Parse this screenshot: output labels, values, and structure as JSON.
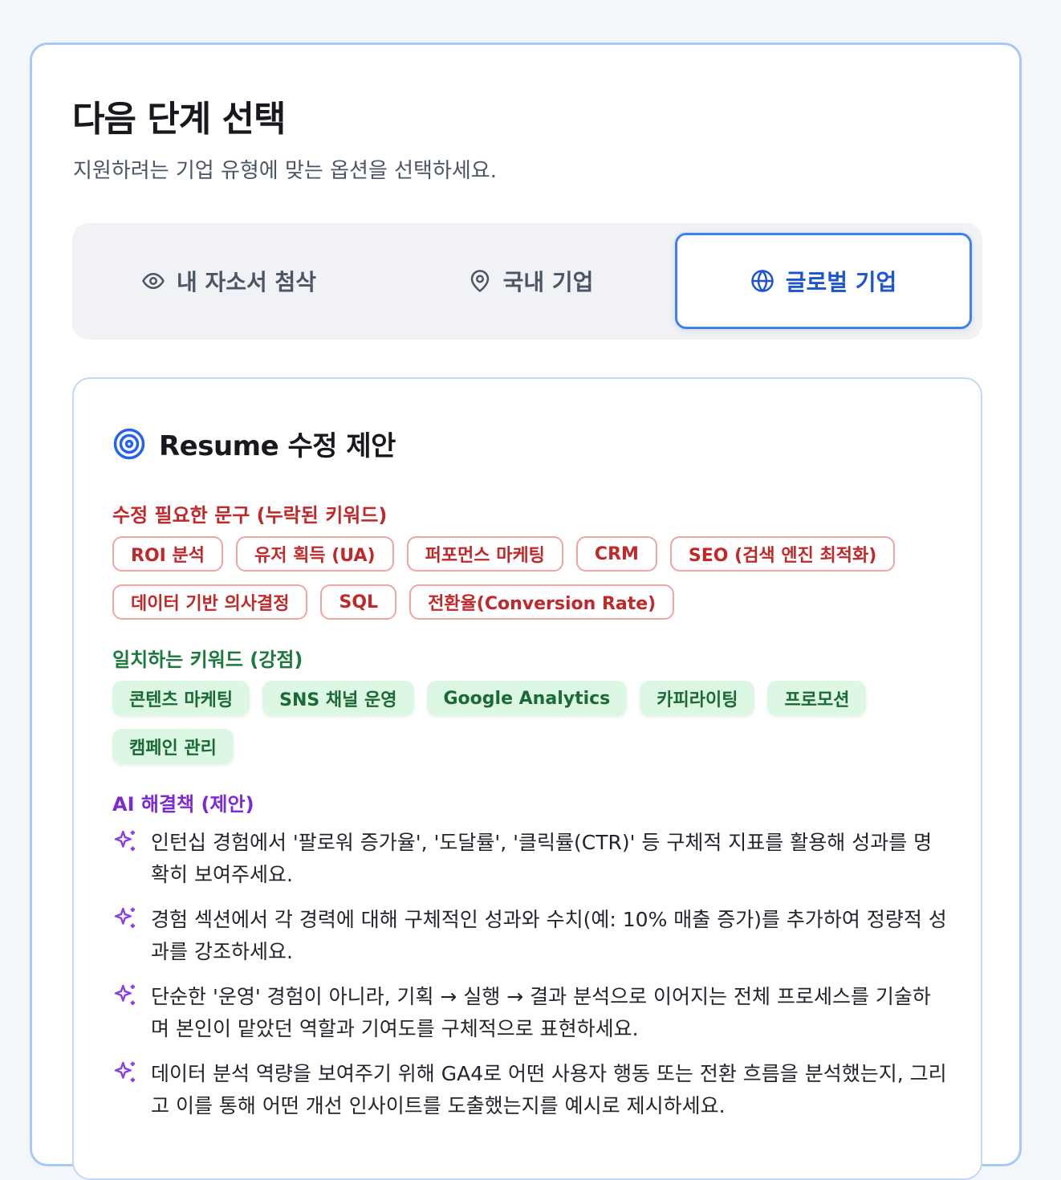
{
  "header": {
    "title": "다음 단계 선택",
    "subtitle": "지원하려는 기업 유형에 맞는 옵션을 선택하세요."
  },
  "tabs": [
    {
      "label": "내 자소서 첨삭",
      "icon": "eye-icon",
      "active": false
    },
    {
      "label": "국내 기업",
      "icon": "map-pin-icon",
      "active": false
    },
    {
      "label": "글로벌 기업",
      "icon": "globe-icon",
      "active": true
    }
  ],
  "panel": {
    "title": "Resume 수정 제안",
    "icon": "target-icon",
    "missing": {
      "label": "수정 필요한 문구 (누락된 키워드)",
      "keywords": [
        "ROI 분석",
        "유저 획득 (UA)",
        "퍼포먼스 마케팅",
        "CRM",
        "SEO (검색 엔진 최적화)",
        "데이터 기반 의사결정",
        "SQL",
        "전환율(Conversion Rate)"
      ]
    },
    "matched": {
      "label": "일치하는 키워드 (강점)",
      "keywords": [
        "콘텐츠 마케팅",
        "SNS 채널 운영",
        "Google Analytics",
        "카피라이팅",
        "프로모션",
        "캠페인 관리"
      ]
    },
    "ai": {
      "label": "AI 해결책 (제안)",
      "icon": "sparkles-icon",
      "suggestions": [
        "인턴십 경험에서 '팔로워 증가율', '도달률', '클릭률(CTR)' 등 구체적 지표를 활용해 성과를 명확히 보여주세요.",
        "경험 섹션에서 각 경력에 대해 구체적인 성과와 수치(예: 10% 매출 증가)를 추가하여 정량적 성과를 강조하세요.",
        "단순한 '운영' 경험이 아니라, 기획 → 실행 → 결과 분석으로 이어지는 전체 프로세스를 기술하며 본인이 맡았던 역할과 기여도를 구체적으로 표현하세요.",
        "데이터 분석 역량을 보여주기 위해 GA4로 어떤 사용자 행동 또는 전환 흐름을 분석했는지, 그리고 이를 통해 어떤 개선 인사이트를 도출했는지를 예시로 제시하세요."
      ]
    }
  },
  "colors": {
    "accent": "#3f82ef",
    "missing": "#c0282a",
    "matched": "#1a7a3c",
    "ai": "#7b2bd1"
  }
}
